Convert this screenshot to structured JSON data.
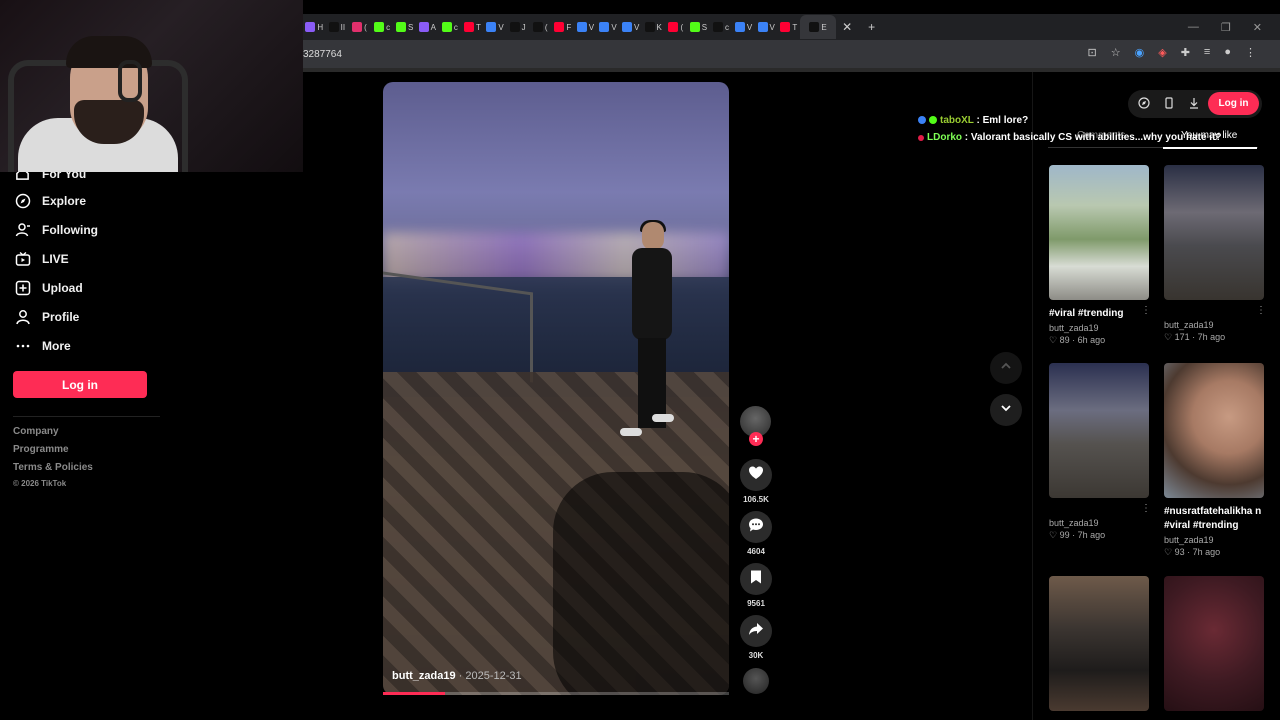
{
  "browser": {
    "url": "3287764",
    "tabs": [
      {
        "color": "#8a5cf6",
        "label": "H"
      },
      {
        "color": "#111111",
        "label": "II"
      },
      {
        "color": "#e1306c",
        "label": "("
      },
      {
        "color": "#53fc18",
        "label": "c"
      },
      {
        "color": "#53fc18",
        "label": "S"
      },
      {
        "color": "#8a5cf6",
        "label": "A"
      },
      {
        "color": "#53fc18",
        "label": "c"
      },
      {
        "color": "#ff0033",
        "label": "T"
      },
      {
        "color": "#3b82f6",
        "label": "V"
      },
      {
        "color": "#111111",
        "label": "J"
      },
      {
        "color": "#111111",
        "label": "("
      },
      {
        "color": "#ff0033",
        "label": "F"
      },
      {
        "color": "#3b82f6",
        "label": "V"
      },
      {
        "color": "#3b82f6",
        "label": "V"
      },
      {
        "color": "#3b82f6",
        "label": "V"
      },
      {
        "color": "#111111",
        "label": "K"
      },
      {
        "color": "#ff0033",
        "label": "("
      },
      {
        "color": "#53fc18",
        "label": "S"
      },
      {
        "color": "#111111",
        "label": "c"
      },
      {
        "color": "#3b82f6",
        "label": "V"
      },
      {
        "color": "#3b82f6",
        "label": "V"
      },
      {
        "color": "#ff0033",
        "label": "T"
      },
      {
        "color": "#111111",
        "label": "E"
      }
    ],
    "new_tab": "+",
    "close_tab": "✕"
  },
  "sidebar": {
    "items": [
      {
        "label": "For You",
        "icon": "home-icon"
      },
      {
        "label": "Explore",
        "icon": "compass-icon"
      },
      {
        "label": "Following",
        "icon": "following-icon"
      },
      {
        "label": "LIVE",
        "icon": "live-icon"
      },
      {
        "label": "Upload",
        "icon": "upload-icon"
      },
      {
        "label": "Profile",
        "icon": "profile-icon"
      },
      {
        "label": "More",
        "icon": "more-icon"
      }
    ],
    "login": "Log in",
    "footer": [
      "Company",
      "Programme",
      "Terms & Policies"
    ],
    "copyright": "© 2026 TikTok"
  },
  "video": {
    "author": "butt_zada19",
    "date": "· 2025-12-31",
    "progress": 0.18
  },
  "actions": {
    "likes": "106.5K",
    "comments": "4604",
    "saves": "9561",
    "shares": "30K",
    "follow": "+"
  },
  "chat": [
    {
      "user": "taboXL",
      "message": ": Eml lore?"
    },
    {
      "user": "LDorko",
      "message": ": Valorant basically CS with abilities...why you hate it?"
    }
  ],
  "right_panel": {
    "login": "Log in",
    "tabs": [
      "Comments",
      "You may like"
    ],
    "cards": [
      {
        "title": "#viral #trending",
        "user": "butt_zada19",
        "likes": "89",
        "time": "6h ago"
      },
      {
        "title": "",
        "user": "butt_zada19",
        "likes": "171",
        "time": "7h ago"
      },
      {
        "title": "",
        "user": "butt_zada19",
        "likes": "99",
        "time": "7h ago"
      },
      {
        "title": "#nusratfatehalikha n #viral #trending",
        "user": "butt_zada19",
        "likes": "93",
        "time": "7h ago"
      }
    ]
  },
  "colors": {
    "accent": "#fe2c55",
    "background": "#000000"
  }
}
